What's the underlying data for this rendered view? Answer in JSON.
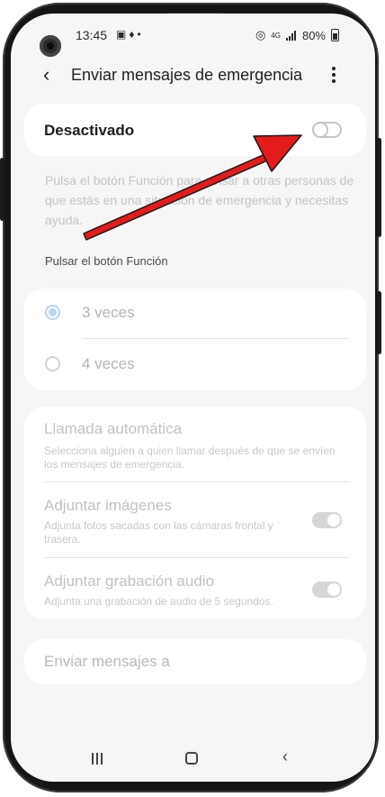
{
  "status_bar": {
    "time": "13:45",
    "left_icons": [
      "image-icon",
      "microphone-icon",
      "notification-dot-icon"
    ],
    "network": "4G",
    "battery": "80%"
  },
  "app_bar": {
    "title": "Enviar mensajes de emergencia"
  },
  "master_switch": {
    "label": "Desactivado",
    "state": "off"
  },
  "description": "Pulsa el botón Función para avisar a otras personas de que estás en una situación de emergencia y necesitas ayuda.",
  "press_section": {
    "label": "Pulsar el botón Función",
    "options": [
      {
        "label": "3 veces",
        "selected": true
      },
      {
        "label": "4 veces",
        "selected": false
      }
    ]
  },
  "settings": {
    "auto_call": {
      "title": "Llamada automática",
      "subtitle": "Selecciona alguien a quien llamar después de que se envíen los mensajes de emergencia."
    },
    "attach_images": {
      "title": "Adjuntar imágenes",
      "subtitle": "Adjunta fotos sacadas con las cámaras frontal y trasera.",
      "state": "on"
    },
    "attach_audio": {
      "title": "Adjuntar grabación audio",
      "subtitle": "Adjunta una grabación de audio de 5 segundos.",
      "state": "on"
    }
  },
  "send_to": {
    "label": "Enviar mensajes a"
  },
  "nav_bar": {
    "icons": [
      "recents-icon",
      "home-icon",
      "back-icon"
    ]
  },
  "colors": {
    "annotation_arrow": "#e41b1b",
    "disabled_text": "#c2c2c2",
    "radio_selected": "#b8d4f2"
  }
}
